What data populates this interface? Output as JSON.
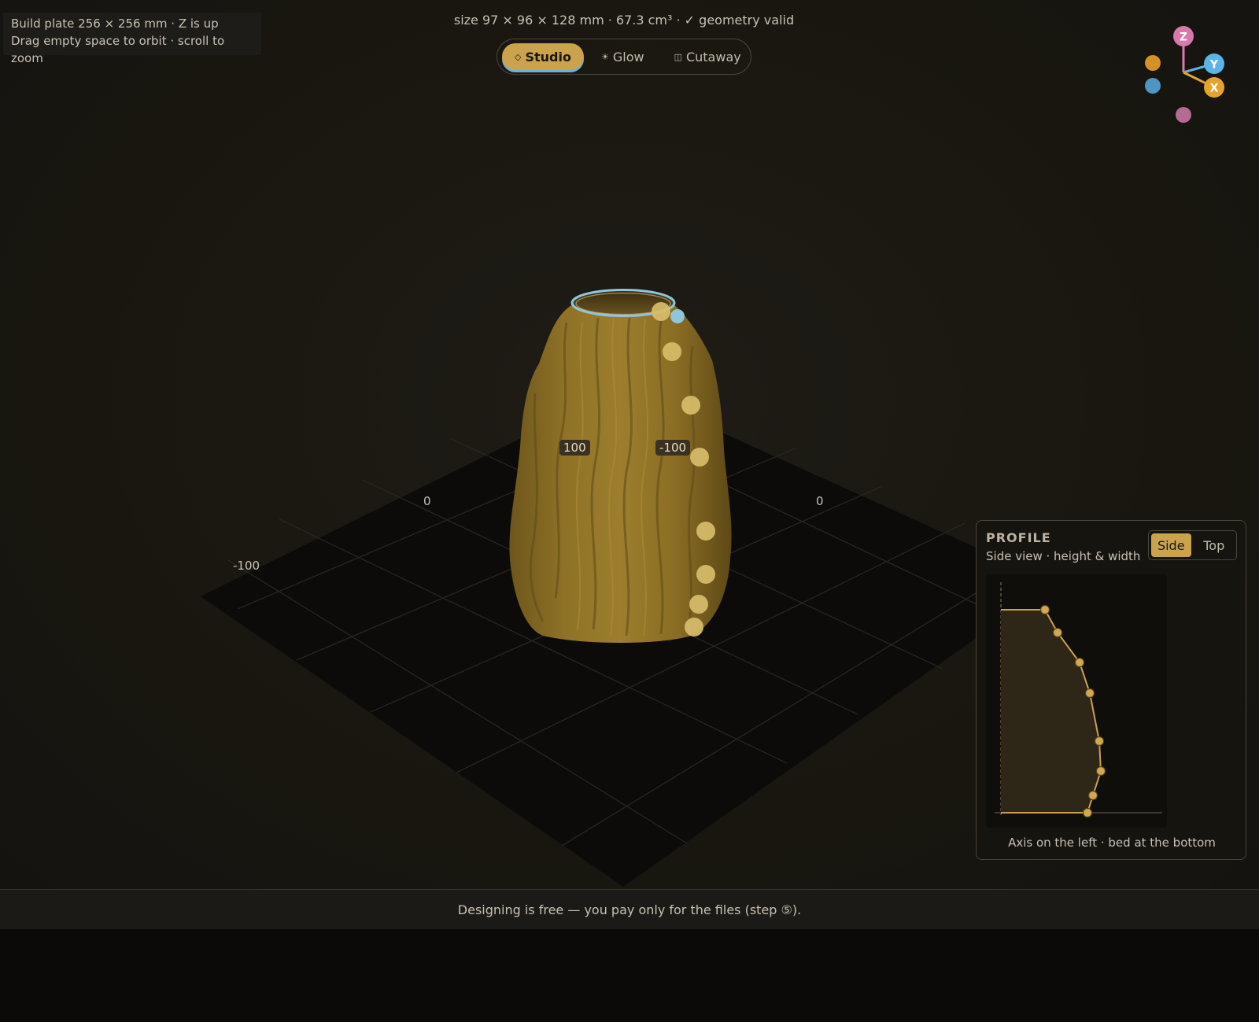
{
  "viewport": {
    "info_line1": "Build plate 256 × 256 mm · Z is up",
    "info_line2": "Drag empty space to orbit · scroll to zoom",
    "stats": "size 97 × 96 × 128 mm · 67.3 cm³ · ✓ geometry valid",
    "axis_labels": [
      "0",
      "0",
      "-100"
    ],
    "tags": [
      "100",
      "-100"
    ]
  },
  "modes": [
    {
      "label": "Studio",
      "glyph": "◇",
      "active": true
    },
    {
      "label": "Glow",
      "glyph": "☀",
      "active": false
    },
    {
      "label": "Cutaway",
      "glyph": "◫",
      "active": false
    }
  ],
  "gizmo": {
    "z_label": "Z",
    "y_label": "Y",
    "x_label": "X",
    "colors": {
      "z": "#d779aa",
      "y": "#5ab4e6",
      "x": "#e7a22c"
    }
  },
  "profile": {
    "title": "PROFILE",
    "subtitle": "Side view · height & width",
    "tabs": [
      {
        "label": "Side",
        "active": true
      },
      {
        "label": "Top",
        "active": false
      }
    ],
    "footnote": "Axis on the left · bed at the bottom"
  },
  "footer": {
    "text": "Designing is free — you pay only for the files (step ⑤)."
  },
  "colors": {
    "accent": "#caa34c",
    "vase": "#8f7226",
    "rim": "#8fc6da",
    "panel_border": "#4a443a"
  }
}
